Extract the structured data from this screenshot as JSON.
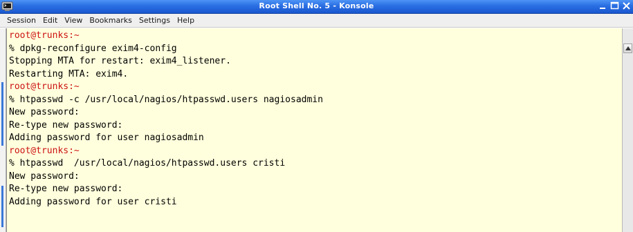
{
  "window": {
    "title": "Root Shell No. 5 - Konsole",
    "app_icon": "konsole-terminal-icon",
    "controls": [
      "minimize-icon",
      "maximize-icon",
      "close-icon"
    ],
    "title_color": "#2a6ee3"
  },
  "menu": {
    "items": [
      {
        "label": "Session"
      },
      {
        "label": "Edit"
      },
      {
        "label": "View"
      },
      {
        "label": "Bookmarks"
      },
      {
        "label": "Settings"
      },
      {
        "label": "Help"
      }
    ]
  },
  "terminal": {
    "background": "#ffffdd",
    "prompt_color": "#cc1111",
    "lines": [
      {
        "text": "root@trunks:~",
        "kind": "prompt"
      },
      {
        "text": "% dpkg-reconfigure exim4-config",
        "kind": "command"
      },
      {
        "text": "Stopping MTA for restart: exim4_listener.",
        "kind": "output"
      },
      {
        "text": "Restarting MTA: exim4.",
        "kind": "output"
      },
      {
        "text": "root@trunks:~",
        "kind": "prompt"
      },
      {
        "text": "% htpasswd -c /usr/local/nagios/htpasswd.users nagiosadmin",
        "kind": "command"
      },
      {
        "text": "New password:",
        "kind": "output"
      },
      {
        "text": "Re-type new password:",
        "kind": "output"
      },
      {
        "text": "Adding password for user nagiosadmin",
        "kind": "output"
      },
      {
        "text": "root@trunks:~",
        "kind": "prompt"
      },
      {
        "text": "% htpasswd  /usr/local/nagios/htpasswd.users cristi",
        "kind": "command"
      },
      {
        "text": "New password:",
        "kind": "output"
      },
      {
        "text": "Re-type new password:",
        "kind": "output"
      },
      {
        "text": "Adding password for user cristi",
        "kind": "output"
      }
    ]
  }
}
